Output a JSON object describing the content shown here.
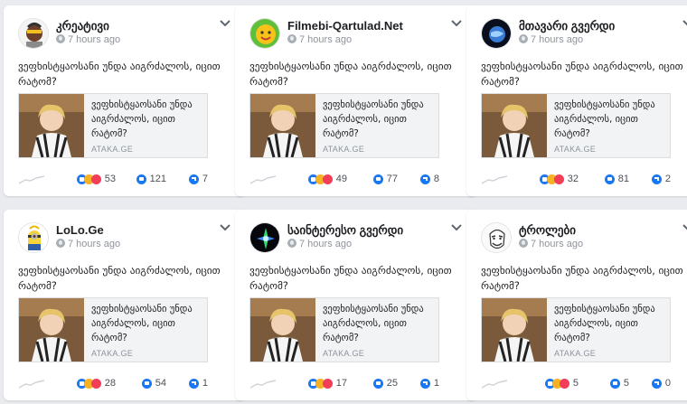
{
  "post": {
    "text": "ვეფხისტყაოსანი უნდა აიგრძალოს, იცით რატომ?",
    "link_title": "ვეფხისტყაოსანი უნდა აიგრძალოს, იცით რატომ?",
    "link_domain": "ATAKA.GE"
  },
  "cards": [
    {
      "page_name": "კრეატივი",
      "time": "7 hours ago",
      "reactions": "53",
      "comments": "121",
      "shares": "7",
      "avatar_icon": "face-avatar-icon"
    },
    {
      "page_name": "Filmebi-Qartulad.Net",
      "time": "7 hours ago",
      "reactions": "49",
      "comments": "77",
      "shares": "8",
      "avatar_icon": "sun-avatar-icon"
    },
    {
      "page_name": "მთავარი გვერდი",
      "time": "7 hours ago",
      "reactions": "32",
      "comments": "81",
      "shares": "2",
      "avatar_icon": "globe-avatar-icon"
    },
    {
      "page_name": "LoLo.Ge",
      "time": "7 hours ago",
      "reactions": "28",
      "comments": "54",
      "shares": "1",
      "avatar_icon": "minion-avatar-icon"
    },
    {
      "page_name": "საინტერესო გვერდი",
      "time": "7 hours ago",
      "reactions": "17",
      "comments": "25",
      "shares": "1",
      "avatar_icon": "spark-avatar-icon"
    },
    {
      "page_name": "ტროლები",
      "time": "7 hours ago",
      "reactions": "5",
      "comments": "5",
      "shares": "0",
      "avatar_icon": "troll-avatar-icon"
    }
  ],
  "colors": {
    "background": "#e9ebee",
    "card": "#ffffff",
    "facebook_blue": "#1877f2",
    "muted_text": "#8d949e"
  }
}
